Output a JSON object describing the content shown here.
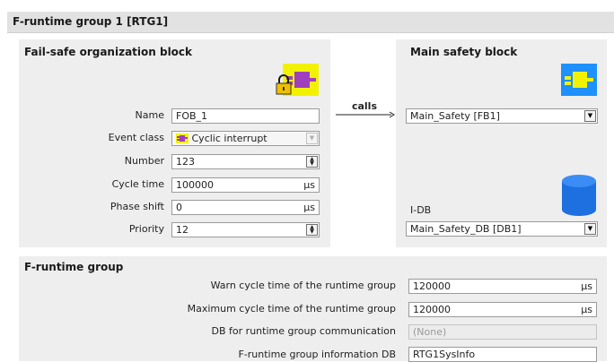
{
  "header": {
    "title": "F-runtime group 1 [RTG1]"
  },
  "fob": {
    "title": "Fail-safe organization block",
    "icon": "fail-safe-ob-lock-icon",
    "fields": {
      "name": {
        "label": "Name",
        "value": "FOB_1"
      },
      "event_class": {
        "label": "Event class",
        "value": "Cyclic interrupt",
        "icon": "cyclic-interrupt-icon"
      },
      "number": {
        "label": "Number",
        "value": "123"
      },
      "cycle_time": {
        "label": "Cycle time",
        "value": "100000",
        "unit": "µs"
      },
      "phase_shift": {
        "label": "Phase shift",
        "value": "0",
        "unit": "µs"
      },
      "priority": {
        "label": "Priority",
        "value": "12"
      }
    }
  },
  "calls": {
    "label": "calls"
  },
  "msb": {
    "title": "Main safety block",
    "icon": "function-block-icon",
    "block_value": "Main_Safety [FB1]",
    "idb_label": "I-DB",
    "idb_icon": "database-cylinder-icon",
    "idb_value": "Main_Safety_DB [DB1]"
  },
  "runtime_group": {
    "title": "F-runtime group",
    "warn": {
      "label": "Warn cycle time of the runtime group",
      "value": "120000",
      "unit": "µs"
    },
    "max": {
      "label": "Maximum cycle time of the runtime group",
      "value": "120000",
      "unit": "µs"
    },
    "comm_db": {
      "label": "DB for runtime group communication",
      "placeholder": "(None)"
    },
    "info_db": {
      "label": "F-runtime group information DB",
      "value": "RTG1SysInfo"
    }
  },
  "colors": {
    "block_yellow": "#f2f200",
    "block_purple": "#a040c0",
    "block_blue": "#1e90ff",
    "panel": "#eeeeee"
  }
}
